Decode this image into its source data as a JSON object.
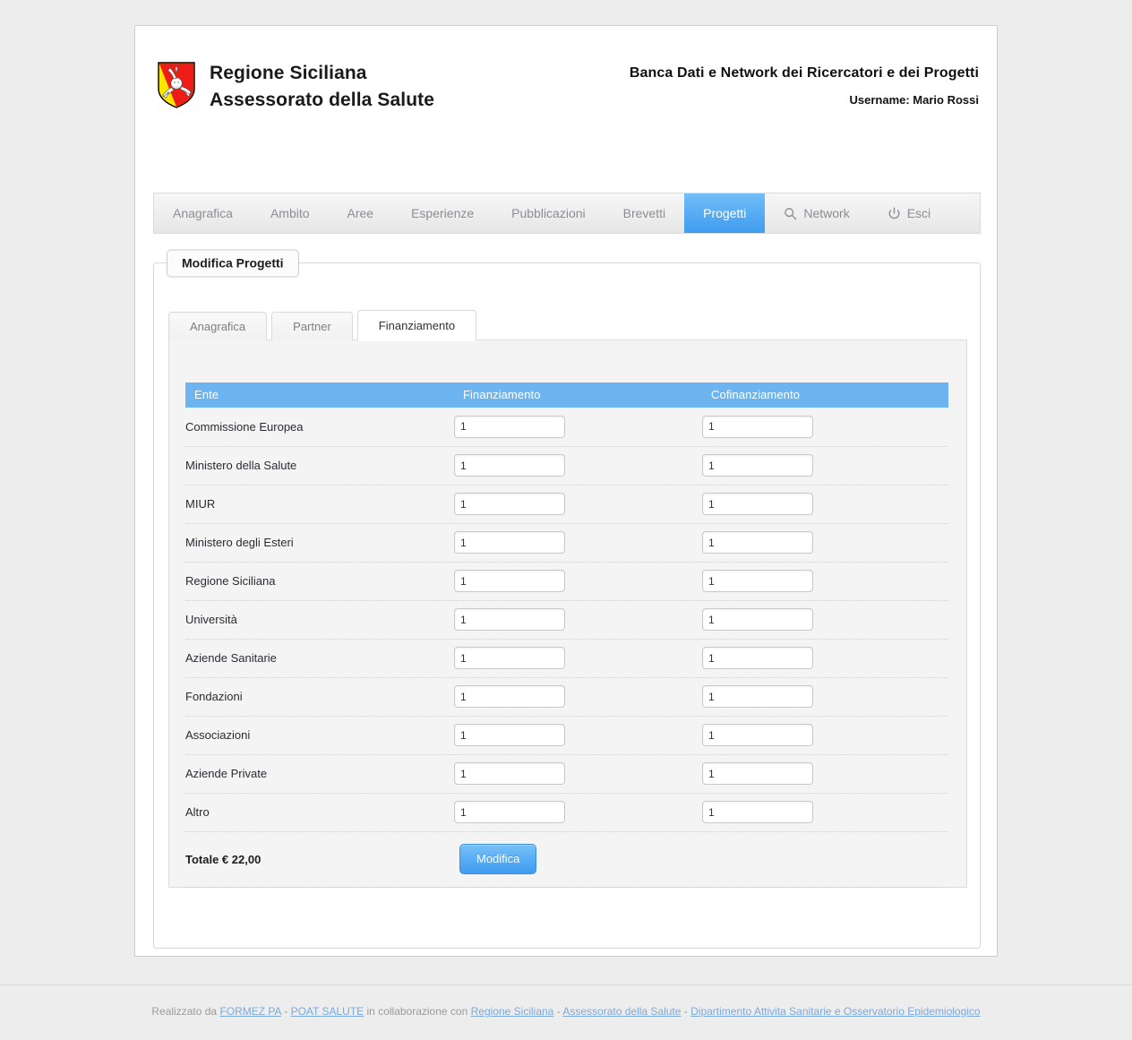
{
  "header": {
    "crest_icon": "sicilian-trinacria-crest",
    "brand_line1": "Regione Siciliana",
    "brand_line2": "Assessorato della Salute",
    "app_title": "Banca Dati e Network dei Ricercatori e dei Progetti",
    "username": "Username: Mario Rossi"
  },
  "nav": {
    "items": [
      {
        "label": "Anagrafica",
        "icon": "",
        "active": false
      },
      {
        "label": "Ambito",
        "icon": "",
        "active": false
      },
      {
        "label": "Aree",
        "icon": "",
        "active": false
      },
      {
        "label": "Esperienze",
        "icon": "",
        "active": false
      },
      {
        "label": "Pubblicazioni",
        "icon": "",
        "active": false
      },
      {
        "label": "Brevetti",
        "icon": "",
        "active": false
      },
      {
        "label": "Progetti",
        "icon": "",
        "active": true
      },
      {
        "label": "Network",
        "icon": "search-icon",
        "active": false
      },
      {
        "label": "Esci",
        "icon": "power-icon",
        "active": false
      }
    ]
  },
  "panel": {
    "legend": "Modifica Progetti",
    "subtabs": [
      {
        "label": "Anagrafica",
        "active": false
      },
      {
        "label": "Partner",
        "active": false
      },
      {
        "label": "Finanziamento",
        "active": true
      }
    ]
  },
  "table": {
    "columns": [
      "Ente",
      "Finanziamento",
      "Cofinanziamento"
    ],
    "rows": [
      {
        "ente": "Commissione Europea",
        "finanziamento": "1",
        "cofinanziamento": "1"
      },
      {
        "ente": "Ministero della Salute",
        "finanziamento": "1",
        "cofinanziamento": "1"
      },
      {
        "ente": "MIUR",
        "finanziamento": "1",
        "cofinanziamento": "1"
      },
      {
        "ente": "Ministero degli Esteri",
        "finanziamento": "1",
        "cofinanziamento": "1"
      },
      {
        "ente": "Regione Siciliana",
        "finanziamento": "1",
        "cofinanziamento": "1"
      },
      {
        "ente": "Università",
        "finanziamento": "1",
        "cofinanziamento": "1"
      },
      {
        "ente": "Aziende Sanitarie",
        "finanziamento": "1",
        "cofinanziamento": "1"
      },
      {
        "ente": "Fondazioni",
        "finanziamento": "1",
        "cofinanziamento": "1"
      },
      {
        "ente": "Associazioni",
        "finanziamento": "1",
        "cofinanziamento": "1"
      },
      {
        "ente": "Aziende Private",
        "finanziamento": "1",
        "cofinanziamento": "1"
      },
      {
        "ente": "Altro",
        "finanziamento": "1",
        "cofinanziamento": "1"
      }
    ],
    "total_label": "Totale € 22,00",
    "submit_label": "Modifica"
  },
  "footer": {
    "prefix": "Realizzato da",
    "link1": "FORMEZ PA",
    "dash1": "-",
    "link2": "POAT SALUTE",
    "middle": "in collaborazione con",
    "link3": "Regione Siciliana",
    "dash2": "-",
    "link4": "Assessorato della Salute",
    "dash3": "-",
    "link5": "Dipartimento Attivita Sanitarie e Osservatorio Epidemiologico"
  },
  "colors": {
    "accent_blue": "#5aaef4",
    "table_header_blue": "#6cb5f0",
    "page_bg": "#ededed",
    "link_blue": "#7aa9dd"
  }
}
